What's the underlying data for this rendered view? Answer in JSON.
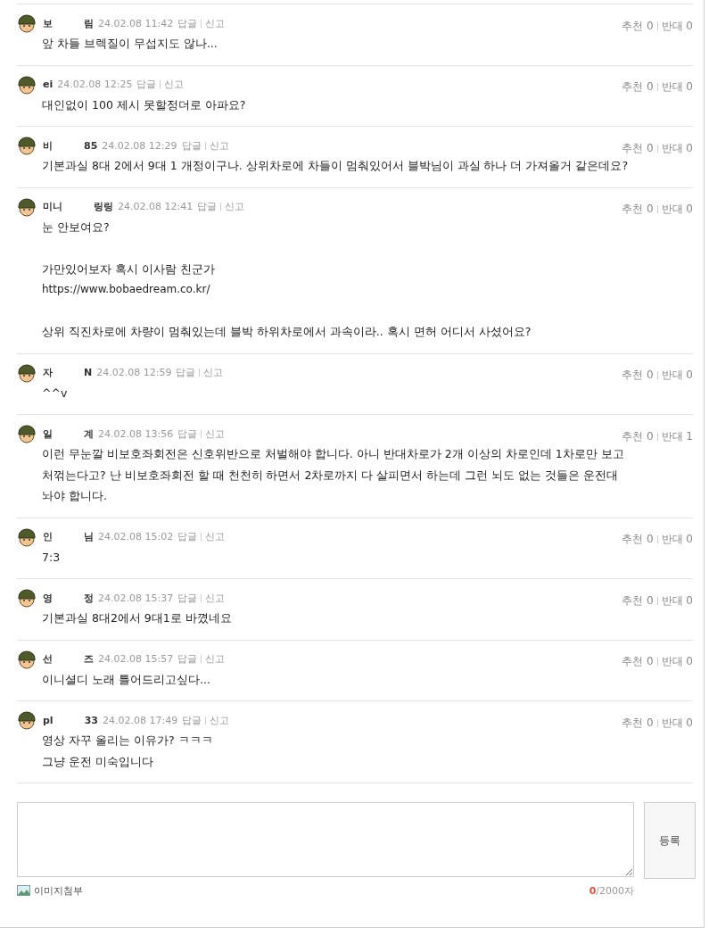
{
  "comments": [
    {
      "author": [
        "보",
        "림"
      ],
      "date": "24.02.08 11:42",
      "reply": "답글",
      "report": "신고",
      "up": "추천 0",
      "down": "반대 0",
      "body": [
        [
          {
            "kind": "text",
            "text": "앞 차들 브렉질이 무섭지도 않나..."
          }
        ]
      ]
    },
    {
      "author": [
        "ei"
      ],
      "date": "24.02.08 12:25",
      "reply": "답글",
      "report": "신고",
      "up": "추천 0",
      "down": "반대 0",
      "body": [
        [
          {
            "kind": "text",
            "text": "대인없이 100 제시 못할정더로 아파요?"
          }
        ]
      ]
    },
    {
      "author": [
        "비",
        "85"
      ],
      "date": "24.02.08 12:29",
      "reply": "답글",
      "report": "신고",
      "up": "추천 0",
      "down": "반대 0",
      "body": [
        [
          {
            "kind": "text",
            "text": "기본과실 8대 2에서 9대 1 개정이구나. 상위차로에 차들이 멈춰있어서 블박님이 과실 하나 더 가져올거 같은데요?"
          }
        ]
      ]
    },
    {
      "author": [
        "미니",
        "링링"
      ],
      "date": "24.02.08 12:41",
      "reply": "답글",
      "report": "신고",
      "up": "추천 0",
      "down": "반대 0",
      "body": [
        [
          {
            "kind": "text",
            "text": "눈 안보여요?"
          }
        ],
        [
          {
            "kind": "text",
            "text": "가만있어보자 혹시 이사람 친군가"
          },
          {
            "kind": "link",
            "text": "https://www.bobaedream.co.kr/"
          }
        ],
        [
          {
            "kind": "text",
            "text": "상위 직진차로에 차량이 멈춰있는데 블박 하위차로에서 과속이라.. 혹시 면허 어디서 사셨어요?"
          }
        ]
      ]
    },
    {
      "author": [
        "자",
        "N"
      ],
      "date": "24.02.08 12:59",
      "reply": "답글",
      "report": "신고",
      "up": "추천 0",
      "down": "반대 0",
      "body": [
        [
          {
            "kind": "text",
            "text": "^^v"
          }
        ]
      ]
    },
    {
      "author": [
        "일",
        "계"
      ],
      "date": "24.02.08 13:56",
      "reply": "답글",
      "report": "신고",
      "up": "추천 0",
      "down": "반대 1",
      "body": [
        [
          {
            "kind": "text",
            "text": "이런 무눈깔 비보호좌회전은 신호위반으로 처벌해야 합니다. 아니 반대차로가 2개 이상의 차로인데 1차로만 보고"
          },
          {
            "kind": "text",
            "text": "처꺾는다고? 난 비보호좌회전 할 때 천천히 하면서 2차로까지 다 살피면서 하는데 그런 뇌도 없는 것들은 운전대"
          },
          {
            "kind": "text",
            "text": "놔야 합니다."
          }
        ]
      ]
    },
    {
      "author": [
        "인",
        "님"
      ],
      "date": "24.02.08 15:02",
      "reply": "답글",
      "report": "신고",
      "up": "추천 0",
      "down": "반대 0",
      "body": [
        [
          {
            "kind": "text",
            "text": "7:3"
          }
        ]
      ]
    },
    {
      "author": [
        "영",
        "정"
      ],
      "date": "24.02.08 15:37",
      "reply": "답글",
      "report": "신고",
      "up": "추천 0",
      "down": "반대 0",
      "body": [
        [
          {
            "kind": "text",
            "text": "기본과실 8대2에서 9대1로 바꼈네요"
          }
        ]
      ]
    },
    {
      "author": [
        "선",
        "즈"
      ],
      "date": "24.02.08 15:57",
      "reply": "답글",
      "report": "신고",
      "up": "추천 0",
      "down": "반대 0",
      "body": [
        [
          {
            "kind": "text",
            "text": "이니셜디 노래 틀어드리고싶다..."
          }
        ]
      ]
    },
    {
      "author": [
        "pl",
        "33"
      ],
      "date": "24.02.08 17:49",
      "reply": "답글",
      "report": "신고",
      "up": "추천 0",
      "down": "반대 0",
      "body": [
        [
          {
            "kind": "text",
            "text": "영상 자꾸 올리는 이유가? ㅋㅋㅋ"
          },
          {
            "kind": "text",
            "text": "그냥 운전 미숙입니다"
          }
        ]
      ]
    }
  ],
  "composer": {
    "submit": "등록",
    "attach": "이미지첨부",
    "count": "0",
    "limit": "/2000자"
  }
}
